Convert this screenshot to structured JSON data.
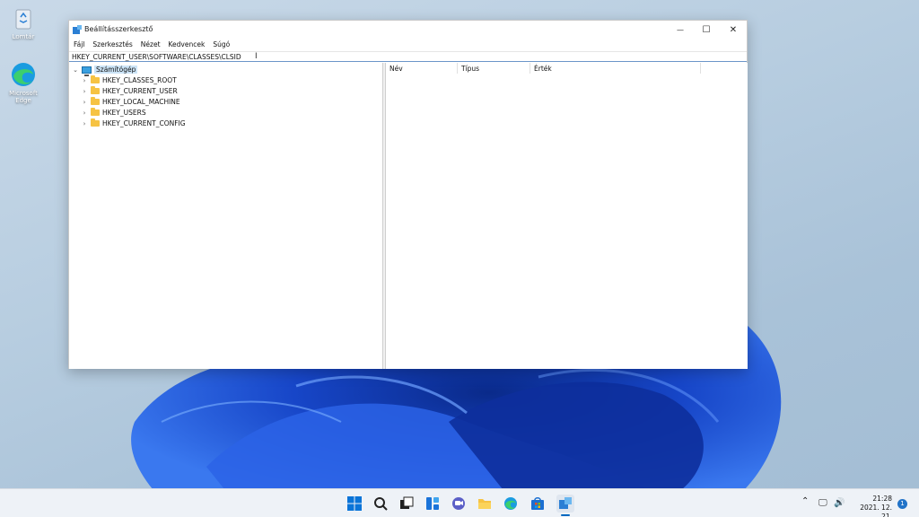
{
  "desktop": {
    "icons": [
      {
        "label": "Lomtár",
        "icon": "recycle-bin-icon"
      },
      {
        "label": "Microsoft Edge",
        "icon": "edge-icon"
      }
    ]
  },
  "window": {
    "title": "Beállításszerkesztő",
    "controls": {
      "minimize": "—",
      "maximize": "☐",
      "close": "✕"
    },
    "menu": [
      "Fájl",
      "Szerkesztés",
      "Nézet",
      "Kedvencek",
      "Súgó"
    ],
    "address": "HKEY_CURRENT_USER\\SOFTWARE\\CLASSES\\CLSID",
    "tree": {
      "root": {
        "label": "Számítógép",
        "expanded": true
      },
      "children": [
        "HKEY_CLASSES_ROOT",
        "HKEY_CURRENT_USER",
        "HKEY_LOCAL_MACHINE",
        "HKEY_USERS",
        "HKEY_CURRENT_CONFIG"
      ]
    },
    "list_columns": [
      "Név",
      "Típus",
      "Érték"
    ]
  },
  "taskbar": {
    "apps": [
      "start-icon",
      "search-icon",
      "task-view-icon",
      "widgets-icon",
      "chat-icon",
      "file-explorer-icon",
      "edge-icon",
      "store-icon",
      "regedit-icon"
    ],
    "time": "21:28",
    "date": "2021. 12. 21.",
    "notifications": "1"
  },
  "colors": {
    "accent": "#0067c0",
    "folder": "#f6c343",
    "wallpaper": "#1f4fd8"
  }
}
